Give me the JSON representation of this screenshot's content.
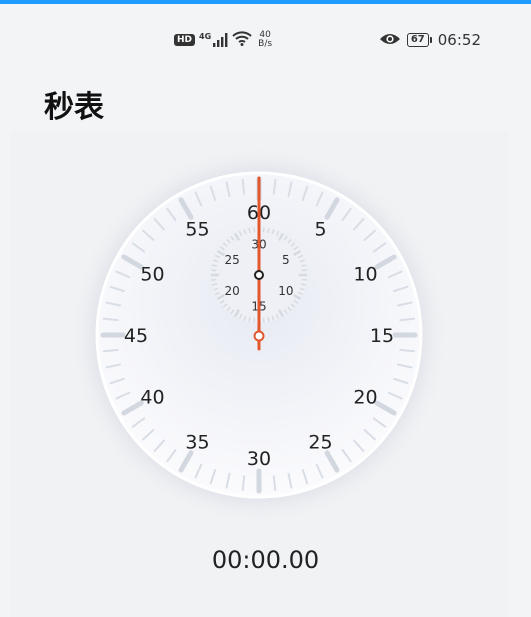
{
  "app": {
    "title": "秒表"
  },
  "status_bar": {
    "hd_badge": "HD",
    "network_type": "4G",
    "net_speed_value": "40",
    "net_speed_unit": "B/s",
    "battery_level": "67",
    "time": "06:52"
  },
  "dial": {
    "outer_labels": [
      "60",
      "5",
      "10",
      "15",
      "20",
      "25",
      "30",
      "35",
      "40",
      "45",
      "50",
      "55"
    ],
    "inner_labels": [
      "30",
      "5",
      "10",
      "15",
      "20",
      "25"
    ]
  },
  "readout": {
    "elapsed": "00:00.00"
  },
  "colors": {
    "accent_top": "#1e9bff",
    "hand": "#e2572e"
  },
  "icons": [
    "hd-icon",
    "signal-icon",
    "wifi-icon",
    "eye-icon",
    "battery-icon"
  ]
}
